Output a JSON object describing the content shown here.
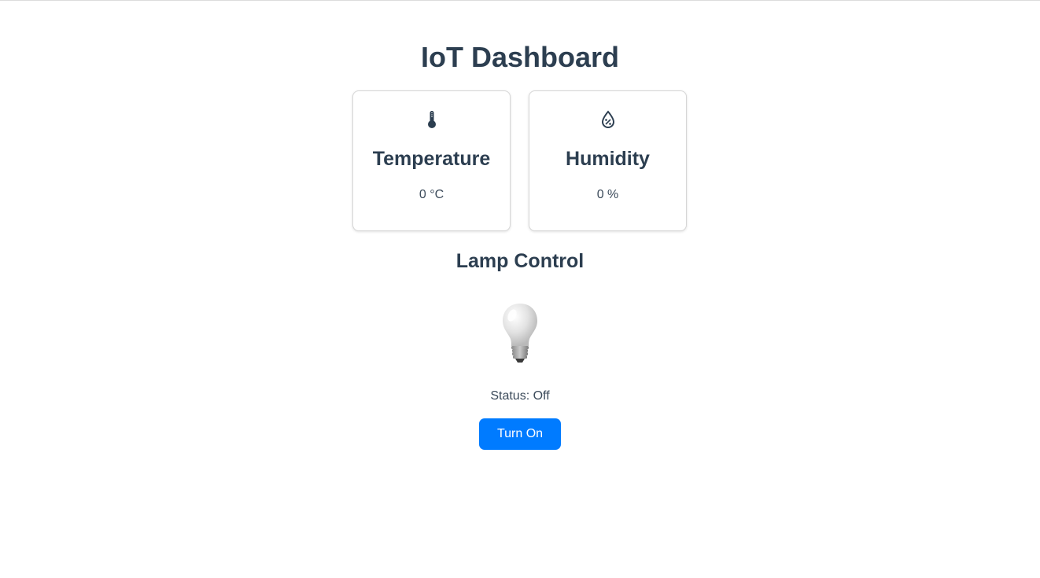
{
  "page": {
    "title": "IoT Dashboard"
  },
  "sensors": [
    {
      "label": "Temperature",
      "value": "0 °C",
      "icon": "thermometer-icon"
    },
    {
      "label": "Humidity",
      "value": "0 %",
      "icon": "water-drop-percent-icon"
    }
  ],
  "lamp": {
    "heading": "Lamp Control",
    "icon": "light-bulb-icon",
    "status_text": "Status: Off",
    "button_label": "Turn On"
  },
  "colors": {
    "accent": "#007bff",
    "text": "#2c3e50"
  }
}
